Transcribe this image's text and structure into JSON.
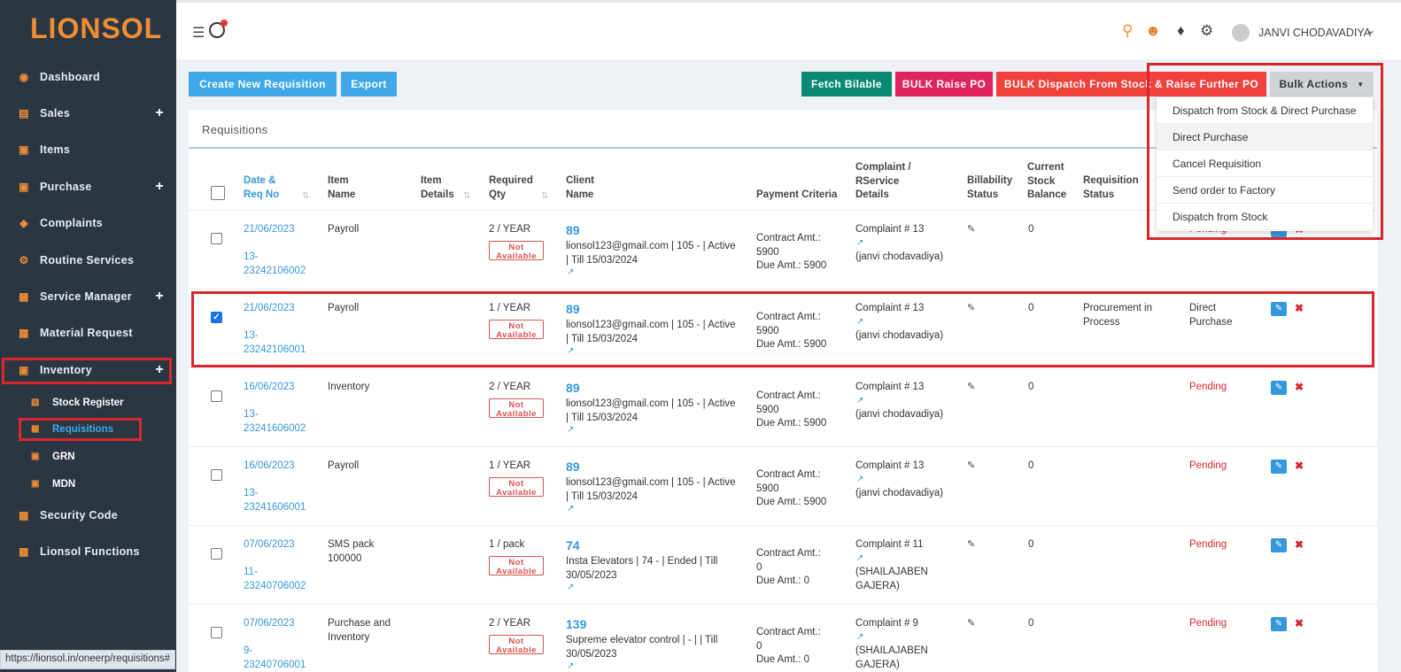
{
  "app": {
    "logo": "LIONSOL"
  },
  "sidebar": {
    "items": [
      {
        "label": "Dashboard",
        "icon": "dashboard-icon",
        "has_plus": false
      },
      {
        "label": "Sales",
        "icon": "cart-icon",
        "has_plus": true
      },
      {
        "label": "Items",
        "icon": "box-icon",
        "has_plus": false
      },
      {
        "label": "Purchase",
        "icon": "briefcase-icon",
        "has_plus": true
      },
      {
        "label": "Complaints",
        "icon": "tag-icon",
        "has_plus": false
      },
      {
        "label": "Routine Services",
        "icon": "gears-icon",
        "has_plus": false
      },
      {
        "label": "Service Manager",
        "icon": "grid-icon",
        "has_plus": true
      },
      {
        "label": "Material Request",
        "icon": "grid-icon",
        "has_plus": false
      },
      {
        "label": "Inventory",
        "icon": "box-icon",
        "has_plus": true
      },
      {
        "label": "Security Code",
        "icon": "grid-icon",
        "has_plus": false
      },
      {
        "label": "Lionsol Functions",
        "icon": "grid-icon",
        "has_plus": false
      }
    ],
    "sub_items": [
      {
        "label": "Stock Register",
        "icon": "inbox-icon"
      },
      {
        "label": "Requisitions",
        "icon": "grid-icon"
      },
      {
        "label": "GRN",
        "icon": "box-icon"
      },
      {
        "label": "MDN",
        "icon": "box-icon"
      }
    ]
  },
  "topbar": {
    "user_name": "JANVI CHODAVADIYA"
  },
  "toolbar": {
    "create_label": "Create New Requisition",
    "export_label": "Export",
    "fetch_label": "Fetch Bilable",
    "bulk_raise_label": "BULK Raise PO",
    "bulk_dispatch_label": "BULK Dispatch From Stock & Raise Further PO",
    "bulk_actions_label": "Bulk Actions"
  },
  "bulk_menu": [
    "Dispatch from Stock & Direct Purchase",
    "Direct Purchase",
    "Cancel Requisition",
    "Send order to Factory",
    "Dispatch from Stock"
  ],
  "panel": {
    "title": "Requisitions"
  },
  "table": {
    "headers": {
      "date": "Date & Req No",
      "item_name": "Item Name",
      "item_details": "Item Details",
      "qty": "Required Qty",
      "client": "Client Name",
      "payment": "Payment Criteria",
      "complaint": "Complaint / RService Details",
      "billability": "Billability Status",
      "stock": "Current Stock Balance",
      "req_status": "Requisition Status"
    },
    "not_available": "Not Available",
    "rows": [
      {
        "date": "21/06/2023",
        "req_no": "13-23242106002",
        "item": "Payroll",
        "qty": "2 / YEAR",
        "client_id": "89",
        "client_info": "lionsol123@gmail.com | 105 - | Active | Till 15/03/2024",
        "contract": "Contract Amt.: 5900",
        "due": "Due Amt.: 5900",
        "complaint": "Complaint # 13",
        "complaint_by": "(janvi chodavadiya)",
        "stock": "0",
        "req_status": "",
        "action_status": "Pending",
        "checked": false
      },
      {
        "date": "21/06/2023",
        "req_no": "13-23242106001",
        "item": "Payroll",
        "qty": "1 / YEAR",
        "client_id": "89",
        "client_info": "lionsol123@gmail.com | 105 - | Active | Till 15/03/2024",
        "contract": "Contract Amt.: 5900",
        "due": "Due Amt.: 5900",
        "complaint": "Complaint # 13",
        "complaint_by": "(janvi chodavadiya)",
        "stock": "0",
        "req_status": "Procurement in Process",
        "action_status": "Direct Purchase",
        "checked": true
      },
      {
        "date": "16/06/2023",
        "req_no": "13-23241606002",
        "item": "Inventory",
        "qty": "2 / YEAR",
        "client_id": "89",
        "client_info": "lionsol123@gmail.com | 105 - | Active | Till 15/03/2024",
        "contract": "Contract Amt.: 5900",
        "due": "Due Amt.: 5900",
        "complaint": "Complaint # 13",
        "complaint_by": "(janvi chodavadiya)",
        "stock": "0",
        "req_status": "",
        "action_status": "Pending",
        "checked": false
      },
      {
        "date": "16/06/2023",
        "req_no": "13-23241606001",
        "item": "Payroll",
        "qty": "1 / YEAR",
        "client_id": "89",
        "client_info": "lionsol123@gmail.com | 105 - | Active | Till 15/03/2024",
        "contract": "Contract Amt.: 5900",
        "due": "Due Amt.: 5900",
        "complaint": "Complaint # 13",
        "complaint_by": "(janvi chodavadiya)",
        "stock": "0",
        "req_status": "",
        "action_status": "Pending",
        "checked": false
      },
      {
        "date": "07/06/2023",
        "req_no": "11-23240706002",
        "item": "SMS pack 100000",
        "qty": "1 / pack",
        "client_id": "74",
        "client_info": "Insta Elevators | 74 - | Ended | Till 30/05/2023",
        "contract": "Contract Amt.: 0",
        "due": "Due Amt.: 0",
        "complaint": "Complaint # 11",
        "complaint_by": "(SHAILAJABEN GAJERA)",
        "stock": "0",
        "req_status": "",
        "action_status": "Pending",
        "checked": false
      },
      {
        "date": "07/06/2023",
        "req_no": "9-23240706001",
        "item": "Purchase and Inventory",
        "qty": "2 / YEAR",
        "client_id": "139",
        "client_info": "Supreme elevator control | - | | Till 30/05/2023",
        "contract": "Contract Amt.: 0",
        "due": "Due Amt.: 0",
        "complaint": "Complaint # 9",
        "complaint_by": "(SHAILAJABEN GAJERA)",
        "stock": "0",
        "req_status": "",
        "action_status": "Pending",
        "checked": false
      }
    ]
  },
  "statusbar": {
    "url": "https://lionsol.in/oneerp/requisitions#"
  },
  "colors": {
    "sidebar_bg": "#2b3643",
    "accent_orange": "#f08c33",
    "link_blue": "#3598dc",
    "fetch_green": "#0b8a72",
    "bulk_raise_pink": "#e0245e",
    "bulk_dispatch_red": "#f0413c",
    "highlight_red": "#d9262c"
  }
}
